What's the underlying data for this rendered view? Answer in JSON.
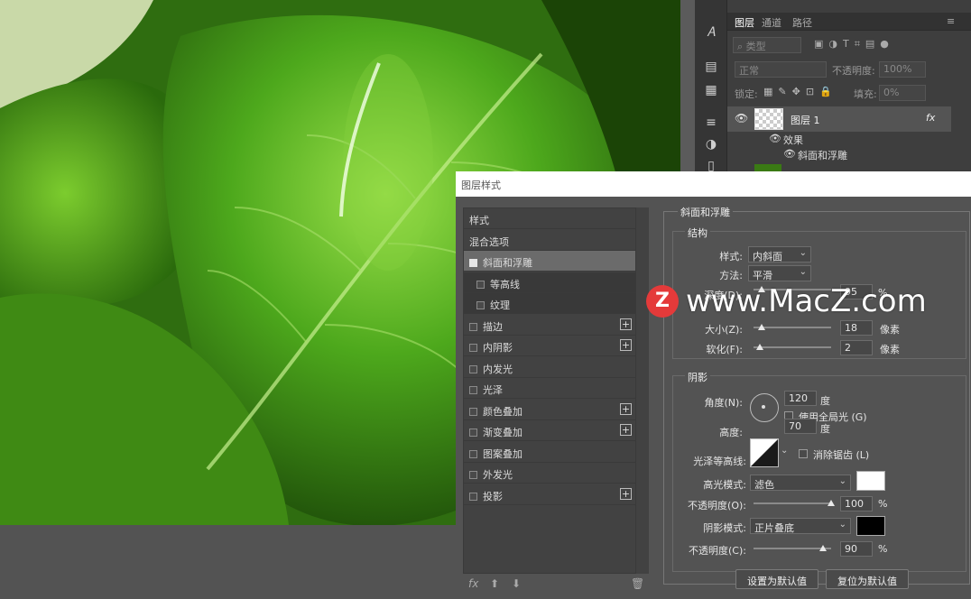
{
  "layers_panel": {
    "tabs": [
      "图层",
      "通道",
      "路径"
    ],
    "filter_kind": "类型",
    "blend_mode": "正常",
    "opacity_label": "不透明度:",
    "opacity_value": "100%",
    "lock_label": "锁定:",
    "fill_label": "填充:",
    "fill_value": "0%",
    "layer_name": "图层 1",
    "fx_badge": "fx",
    "effects_label": "效果",
    "effect_item": "斜面和浮雕"
  },
  "dialog": {
    "title": "图层样式",
    "style_list": [
      {
        "label": "样式",
        "checkbox": false,
        "plus": false,
        "sub": false
      },
      {
        "label": "混合选项",
        "checkbox": false,
        "plus": false,
        "sub": false
      },
      {
        "label": "斜面和浮雕",
        "checkbox": true,
        "checked": true,
        "plus": false,
        "sub": false,
        "selected": true
      },
      {
        "label": "等高线",
        "checkbox": true,
        "checked": false,
        "plus": false,
        "sub": true
      },
      {
        "label": "纹理",
        "checkbox": true,
        "checked": false,
        "plus": false,
        "sub": true
      },
      {
        "label": "描边",
        "checkbox": true,
        "checked": false,
        "plus": true,
        "sub": false
      },
      {
        "label": "内阴影",
        "checkbox": true,
        "checked": false,
        "plus": true,
        "sub": false
      },
      {
        "label": "内发光",
        "checkbox": true,
        "checked": false,
        "plus": false,
        "sub": false
      },
      {
        "label": "光泽",
        "checkbox": true,
        "checked": false,
        "plus": false,
        "sub": false
      },
      {
        "label": "颜色叠加",
        "checkbox": true,
        "checked": false,
        "plus": true,
        "sub": false
      },
      {
        "label": "渐变叠加",
        "checkbox": true,
        "checked": false,
        "plus": true,
        "sub": false
      },
      {
        "label": "图案叠加",
        "checkbox": true,
        "checked": false,
        "plus": false,
        "sub": false
      },
      {
        "label": "外发光",
        "checkbox": true,
        "checked": false,
        "plus": false,
        "sub": false
      },
      {
        "label": "投影",
        "checkbox": true,
        "checked": false,
        "plus": true,
        "sub": false
      }
    ],
    "footer_fx": "fx",
    "section_title": "斜面和浮雕",
    "structure": {
      "title": "结构",
      "style_label": "样式:",
      "style_value": "内斜面",
      "method_label": "方法:",
      "method_value": "平滑",
      "depth_label": "深度(D):",
      "depth_value": "95",
      "depth_unit": "%",
      "depth_level": 0.1,
      "size_label": "大小(Z):",
      "size_value": "18",
      "size_unit": "像素",
      "size_level": 0.1,
      "soften_label": "软化(F):",
      "soften_value": "2",
      "soften_unit": "像素",
      "soften_level": 0.08
    },
    "shading": {
      "title": "阴影",
      "angle_label": "角度(N):",
      "angle_value": "120",
      "angle_unit": "度",
      "global_light_label": "使用全局光 (G)",
      "altitude_label": "高度:",
      "altitude_value": "70",
      "altitude_unit": "度",
      "gloss_label": "光泽等高线:",
      "antialias_label": "消除锯齿 (L)",
      "highlight_label": "高光模式:",
      "highlight_value": "滤色",
      "highlight_color": "#ffffff",
      "hl_opacity_label": "不透明度(O):",
      "hl_opacity_value": "100",
      "hl_opacity_level": 1.0,
      "pct": "%",
      "shadow_label": "阴影模式:",
      "shadow_value": "正片叠底",
      "shadow_color": "#000000",
      "sh_opacity_label": "不透明度(C):",
      "sh_opacity_value": "90",
      "sh_opacity_level": 0.9
    },
    "buttons": {
      "set_default": "设置为默认值",
      "reset_default": "复位为默认值"
    }
  },
  "watermark": {
    "logo_letter": "Z",
    "text": "www.MacZ.com"
  }
}
